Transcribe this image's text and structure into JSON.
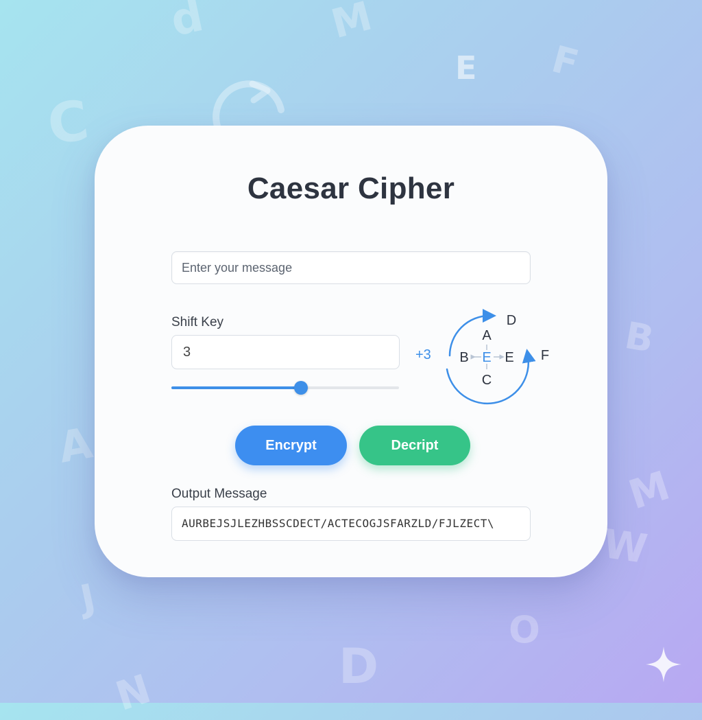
{
  "app": {
    "title": "Caesar Cipher"
  },
  "message_input": {
    "placeholder": "Enter your message",
    "value": ""
  },
  "shift": {
    "label": "Shift Key",
    "value": "3",
    "slider_level": 0.57
  },
  "diagram": {
    "shift_label": "+3",
    "letters": {
      "top": "A",
      "left": "B",
      "center": "E",
      "right": "E",
      "bottom": "C",
      "outer_top": "D",
      "outer_right": "F"
    },
    "accent": "#3d8fe8"
  },
  "buttons": {
    "encrypt": "Encrypt",
    "decrypt": "Decript"
  },
  "output": {
    "label": "Output Message",
    "value": "AURBEJSJLEZHBSSCDECT/ACTECOGJSFARZLD/FJLZECT\\"
  },
  "colors": {
    "encrypt": "#3d8ef0",
    "decrypt": "#36c488",
    "title": "#2e3440"
  },
  "background_letters": [
    "d",
    "M",
    "E",
    "F",
    "C",
    "B",
    "A",
    "M",
    "W",
    "J",
    "O",
    "D",
    "N"
  ]
}
